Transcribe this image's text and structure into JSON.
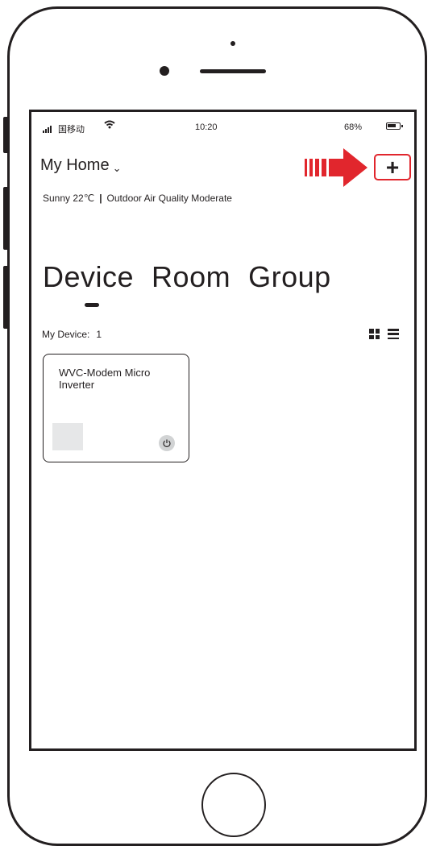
{
  "status_bar": {
    "carrier": "国移动",
    "time": "10:20",
    "battery": "68%"
  },
  "header": {
    "home_name": "My Home",
    "chevron": "⌄",
    "add_label": "+"
  },
  "weather": {
    "condition": "Sunny 22℃",
    "separator": "|",
    "air_quality": "Outdoor Air Quality Moderate"
  },
  "tabs": [
    {
      "label": "Device",
      "selected": true
    },
    {
      "label": "Room",
      "selected": false
    },
    {
      "label": "Group",
      "selected": false
    }
  ],
  "devices": {
    "count_label": "My Device:",
    "count": "1",
    "items": [
      {
        "name": "WVC-Modem Micro Inverter",
        "power": "off"
      }
    ]
  },
  "colors": {
    "accent_red": "#e1262d",
    "ink": "#231f20",
    "thumbnail": "#e6e7e8"
  },
  "icons": {
    "signal": "signal-icon",
    "wifi": "wifi-icon",
    "battery": "battery-icon",
    "arrow": "arrow-right-icon",
    "grid": "grid-view-icon",
    "list": "list-view-icon",
    "power": "power-icon"
  }
}
